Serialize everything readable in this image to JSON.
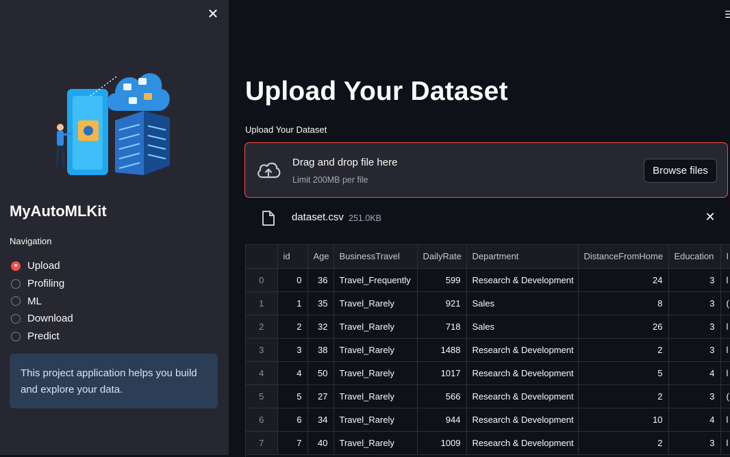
{
  "sidebar": {
    "close_icon": "close-icon",
    "app_title": "MyAutoMLKit",
    "nav_label": "Navigation",
    "nav_items": [
      {
        "label": "Upload",
        "selected": true
      },
      {
        "label": "Profiling",
        "selected": false
      },
      {
        "label": "ML",
        "selected": false
      },
      {
        "label": "Download",
        "selected": false
      },
      {
        "label": "Predict",
        "selected": false
      }
    ],
    "info_text": "This project application helps you build and explore your data."
  },
  "main": {
    "menu_icon": "hamburger-menu-icon",
    "title": "Upload Your Dataset",
    "uploader": {
      "label": "Upload Your Dataset",
      "drop_text": "Drag and drop file here",
      "limit_text": "Limit 200MB per file",
      "browse_label": "Browse files"
    },
    "file": {
      "name": "dataset.csv",
      "size": "251.0KB"
    },
    "table": {
      "columns": [
        "",
        "id",
        "Age",
        "BusinessTravel",
        "DailyRate",
        "Department",
        "DistanceFromHome",
        "Education",
        "I"
      ],
      "rows": [
        [
          "0",
          "0",
          "36",
          "Travel_Frequently",
          "599",
          "Research & Development",
          "24",
          "3",
          "l"
        ],
        [
          "1",
          "1",
          "35",
          "Travel_Rarely",
          "921",
          "Sales",
          "8",
          "3",
          "("
        ],
        [
          "2",
          "2",
          "32",
          "Travel_Rarely",
          "718",
          "Sales",
          "26",
          "3",
          "l"
        ],
        [
          "3",
          "3",
          "38",
          "Travel_Rarely",
          "1488",
          "Research & Development",
          "2",
          "3",
          "l"
        ],
        [
          "4",
          "4",
          "50",
          "Travel_Rarely",
          "1017",
          "Research & Development",
          "5",
          "4",
          "l"
        ],
        [
          "5",
          "5",
          "27",
          "Travel_Rarely",
          "566",
          "Research & Development",
          "2",
          "3",
          "("
        ],
        [
          "6",
          "6",
          "34",
          "Travel_Rarely",
          "944",
          "Research & Development",
          "10",
          "4",
          "l"
        ],
        [
          "7",
          "7",
          "40",
          "Travel_Rarely",
          "1009",
          "Research & Development",
          "2",
          "3",
          "l"
        ]
      ]
    }
  },
  "colors": {
    "accent": "#ff4b4b",
    "sidebar_bg": "#262730",
    "main_bg": "#0e1117",
    "info_bg": "#2c3e55"
  }
}
